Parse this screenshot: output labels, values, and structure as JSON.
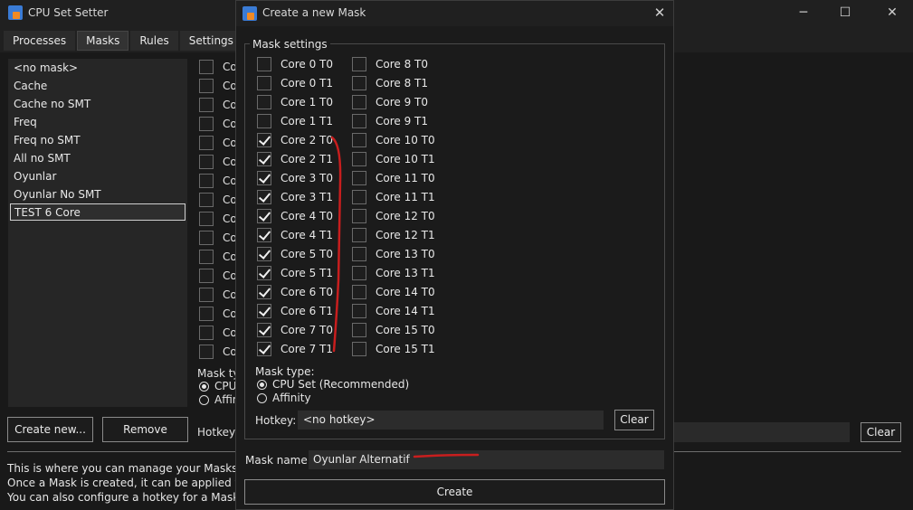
{
  "app": {
    "title": "CPU Set Setter",
    "minimize_glyph": "─",
    "maximize_glyph": "☐",
    "close_glyph": "✕"
  },
  "tabs": [
    "Processes",
    "Masks",
    "Rules",
    "Settings"
  ],
  "masks": [
    "<no mask>",
    "Cache",
    "Cache no SMT",
    "Freq",
    "Freq no SMT",
    "All no SMT",
    "Oyunlar",
    "Oyunlar No SMT",
    "TEST 6 Core"
  ],
  "background": {
    "core_label_prefix": "Co",
    "mask_type_label": "Mask ty",
    "radio_labels": [
      "CPU",
      "Affin"
    ],
    "hotkey_label": "Hotkey:",
    "clear_label": "Clear",
    "create_new_label": "Create new...",
    "remove_label": "Remove"
  },
  "info_lines": [
    "This is where you can manage your Masks. A Ma",
    "Once a Mask is created, it can be applied to a p",
    "You can also configure a hotkey for a Mask, whi"
  ],
  "dialog": {
    "title": "Create a new Mask",
    "close_glyph": "✕",
    "group_title": "Mask settings",
    "cores_left": [
      {
        "label": "Core 0 T0",
        "checked": false
      },
      {
        "label": "Core 0 T1",
        "checked": false
      },
      {
        "label": "Core 1 T0",
        "checked": false
      },
      {
        "label": "Core 1 T1",
        "checked": false
      },
      {
        "label": "Core 2 T0",
        "checked": true
      },
      {
        "label": "Core 2 T1",
        "checked": true
      },
      {
        "label": "Core 3 T0",
        "checked": true
      },
      {
        "label": "Core 3 T1",
        "checked": true
      },
      {
        "label": "Core 4 T0",
        "checked": true
      },
      {
        "label": "Core 4 T1",
        "checked": true
      },
      {
        "label": "Core 5 T0",
        "checked": true
      },
      {
        "label": "Core 5 T1",
        "checked": true
      },
      {
        "label": "Core 6 T0",
        "checked": true
      },
      {
        "label": "Core 6 T1",
        "checked": true
      },
      {
        "label": "Core 7 T0",
        "checked": true
      },
      {
        "label": "Core 7 T1",
        "checked": true
      }
    ],
    "cores_right": [
      {
        "label": "Core 8 T0",
        "checked": false
      },
      {
        "label": "Core 8 T1",
        "checked": false
      },
      {
        "label": "Core 9 T0",
        "checked": false
      },
      {
        "label": "Core 9 T1",
        "checked": false
      },
      {
        "label": "Core 10 T0",
        "checked": false
      },
      {
        "label": "Core 10 T1",
        "checked": false
      },
      {
        "label": "Core 11 T0",
        "checked": false
      },
      {
        "label": "Core 11 T1",
        "checked": false
      },
      {
        "label": "Core 12 T0",
        "checked": false
      },
      {
        "label": "Core 12 T1",
        "checked": false
      },
      {
        "label": "Core 13 T0",
        "checked": false
      },
      {
        "label": "Core 13 T1",
        "checked": false
      },
      {
        "label": "Core 14 T0",
        "checked": false
      },
      {
        "label": "Core 14 T1",
        "checked": false
      },
      {
        "label": "Core 15 T0",
        "checked": false
      },
      {
        "label": "Core 15 T1",
        "checked": false
      }
    ],
    "mask_type_label": "Mask type:",
    "mask_types": [
      {
        "label": "CPU Set (Recommended)",
        "selected": true
      },
      {
        "label": "Affinity",
        "selected": false
      }
    ],
    "hotkey_label": "Hotkey:",
    "hotkey_value": "<no hotkey>",
    "clear_label": "Clear",
    "mask_name_label": "Mask name:",
    "mask_name_value": "Oyunlar Alternatif",
    "create_label": "Create"
  },
  "colors": {
    "annotation": "#c81e1e",
    "background": "#202020",
    "dialog": "#1b1b1b"
  }
}
